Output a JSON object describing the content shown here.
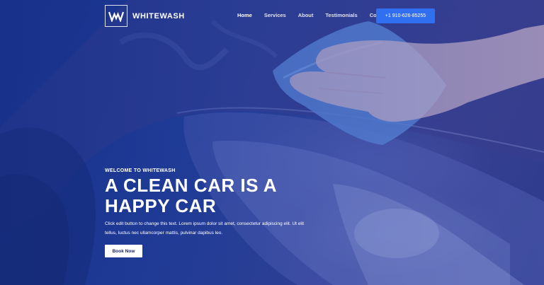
{
  "brand": {
    "name": "WHITEWASH",
    "logo_mark": "W"
  },
  "nav": {
    "items": [
      "Home",
      "Services",
      "About",
      "Testimonials",
      "Contact"
    ],
    "active": "Home",
    "phone_label": "+1 910-626-85255"
  },
  "hero": {
    "eyebrow": "WELCOME TO WHITEWASH",
    "headline_line1": "A CLEAN CAR IS A",
    "headline_line2": "HAPPY CAR",
    "description_line1": "Click edit button to change this text. Lorem ipsum dolor sit amet, consectetur adipiscing elit. Ut elit",
    "description_line2": "tellus, luctus nec ullamcorper mattis, pulvinar dapibus leo.",
    "cta_label": "Book Now"
  },
  "colors": {
    "overlay_blue": "#1d3585",
    "cta_blue": "#2f6ff0",
    "text_white": "#ffffff"
  },
  "icons": [
    "logo-w-icon"
  ]
}
